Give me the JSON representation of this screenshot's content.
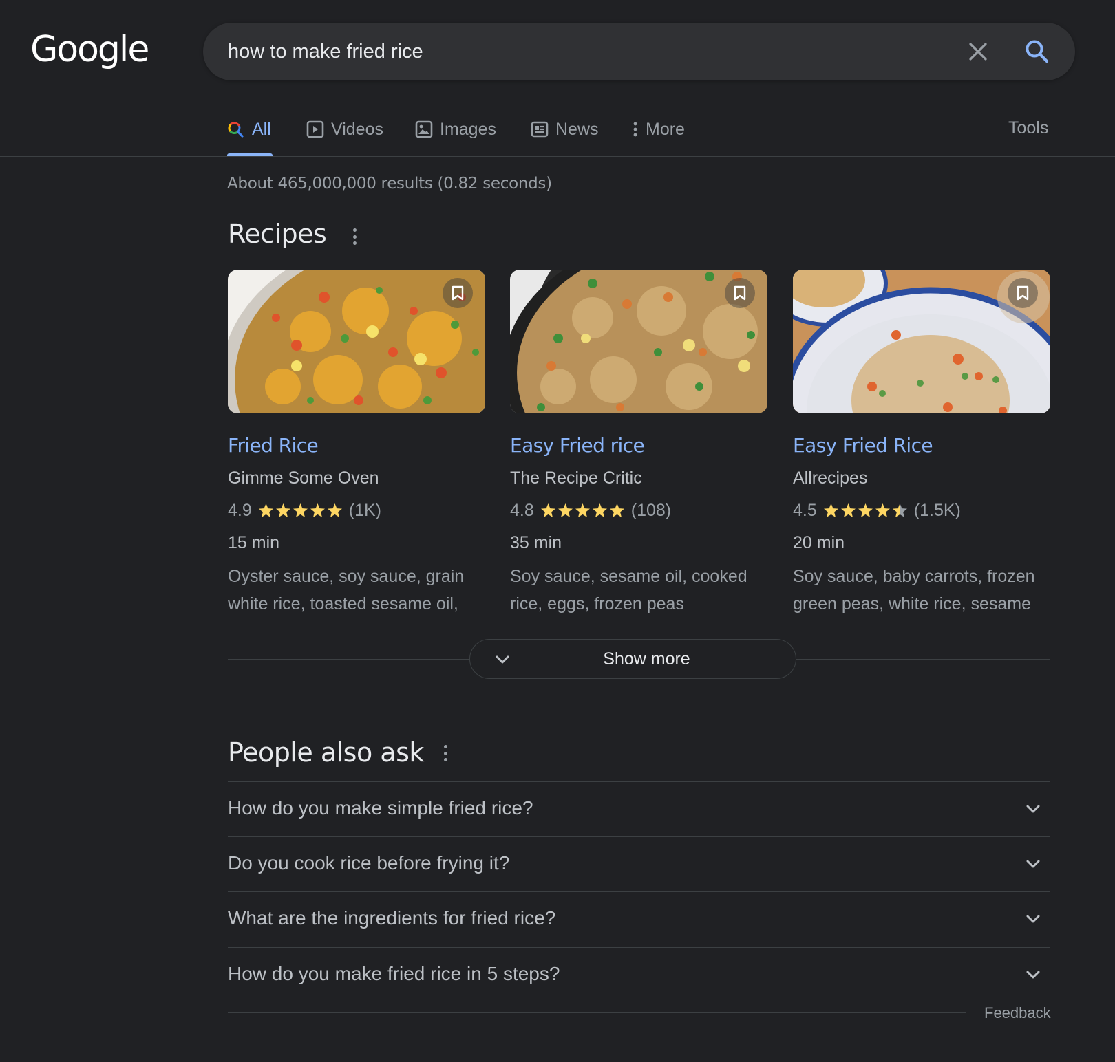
{
  "header": {
    "logo_text": "Google",
    "search": {
      "value": "how to make fried rice",
      "placeholder": ""
    },
    "clear_icon": "close-icon",
    "search_icon": "search-icon",
    "tabs": [
      {
        "label": "All",
        "icon": "search-icon",
        "active": true
      },
      {
        "label": "Videos",
        "icon": "play-icon",
        "active": false
      },
      {
        "label": "Images",
        "icon": "image-icon",
        "active": false
      },
      {
        "label": "News",
        "icon": "news-icon",
        "active": false
      },
      {
        "label": "More",
        "icon": "kebab-icon",
        "active": false
      }
    ],
    "tools_label": "Tools"
  },
  "results_stats": "About 465,000,000 results (0.82 seconds)",
  "recipes": {
    "title": "Recipes",
    "cards": [
      {
        "title": "Fried Rice",
        "source": "Gimme Some Oven",
        "rating": 4.9,
        "rating_text": "4.9",
        "stars": 5,
        "reviews": "(1K)",
        "time": "15 min",
        "ingredients": "Oyster sauce, soy sauce, grain white rice, toasted sesame oil,"
      },
      {
        "title": "Easy Fried rice",
        "source": "The Recipe Critic",
        "rating": 4.8,
        "rating_text": "4.8",
        "stars": 5,
        "reviews": "(108)",
        "time": "35 min",
        "ingredients": "Soy sauce, sesame oil, cooked rice, eggs, frozen peas"
      },
      {
        "title": "Easy Fried Rice",
        "source": "Allrecipes",
        "rating": 4.5,
        "rating_text": "4.5",
        "stars": 4.5,
        "reviews": "(1.5K)",
        "time": "20 min",
        "ingredients": "Soy sauce, baby carrots, frozen green peas, white rice, sesame"
      }
    ],
    "show_more_label": "Show more"
  },
  "people_also_ask": {
    "title": "People also ask",
    "questions": [
      "How do you make simple fried rice?",
      "Do you cook rice before frying it?",
      "What are the ingredients for fried rice?",
      "How do you make fried rice in 5 steps?"
    ]
  },
  "feedback_label": "Feedback",
  "colors": {
    "background": "#202124",
    "link": "#8ab4f8",
    "star": "#fdd663",
    "star_empty": "#9aa0a6",
    "divider": "#3c4043"
  }
}
